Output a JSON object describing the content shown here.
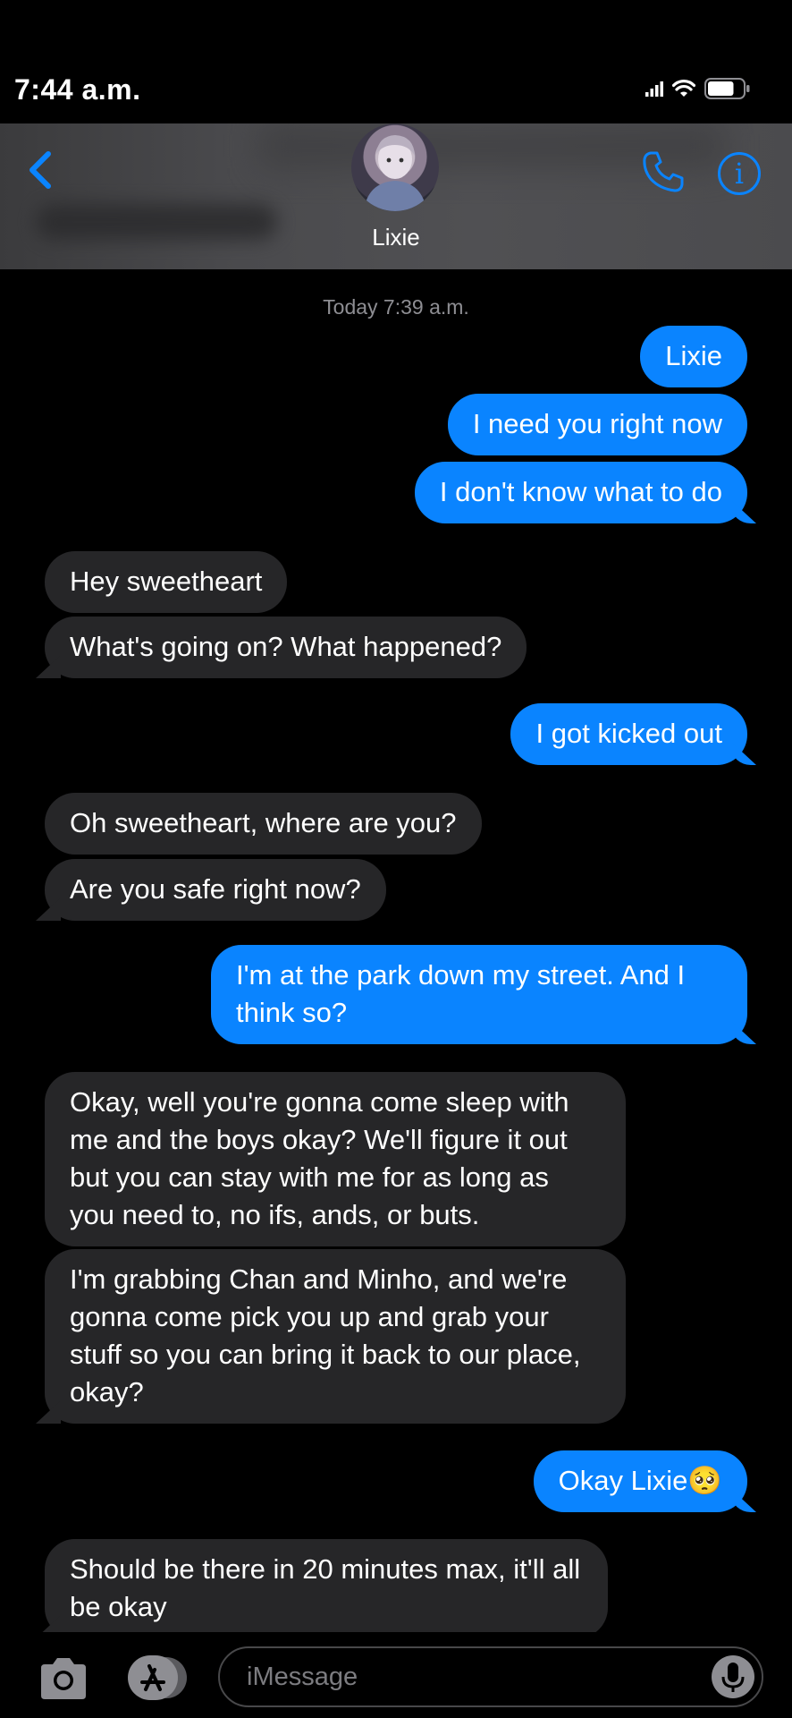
{
  "status_bar": {
    "time": "7:44 a.m.",
    "battery_level": 0.75
  },
  "header": {
    "contact_name": "Lixie"
  },
  "timestamp": "Today 7:39 a.m.",
  "messages": [
    {
      "from": "me",
      "text": "Lixie"
    },
    {
      "from": "me",
      "text": "I need you right now"
    },
    {
      "from": "me",
      "text": "I don't know what to do"
    },
    {
      "from": "them",
      "text": "Hey sweetheart"
    },
    {
      "from": "them",
      "text": "What's going on? What happened?"
    },
    {
      "from": "me",
      "text": "I got kicked out"
    },
    {
      "from": "them",
      "text": "Oh sweetheart, where are you?"
    },
    {
      "from": "them",
      "text": "Are you safe right now?"
    },
    {
      "from": "me",
      "text": "I'm at the park down my street. And I think so?"
    },
    {
      "from": "them",
      "text": "Okay, well you're gonna come sleep with me and the boys okay? We'll figure it out but you can stay with me for as long as you need to, no ifs, ands, or buts."
    },
    {
      "from": "them",
      "text": "I'm grabbing Chan and Minho, and we're gonna come pick you up and grab your stuff so you can bring it back to our place, okay?"
    },
    {
      "from": "me",
      "text": "Okay Lixie",
      "emoji": "🥺"
    },
    {
      "from": "them",
      "text": "Should be there in 20 minutes max, it'll all be okay"
    }
  ],
  "input": {
    "placeholder": "iMessage"
  },
  "colors": {
    "sent_bubble": "#0a84ff",
    "received_bubble": "#262628",
    "accent": "#0a84ff"
  },
  "icons": [
    "back-chevron-icon",
    "phone-icon",
    "info-icon",
    "camera-icon",
    "app-store-icon",
    "microphone-icon",
    "cellular-signal-icon",
    "wifi-icon",
    "battery-icon"
  ]
}
